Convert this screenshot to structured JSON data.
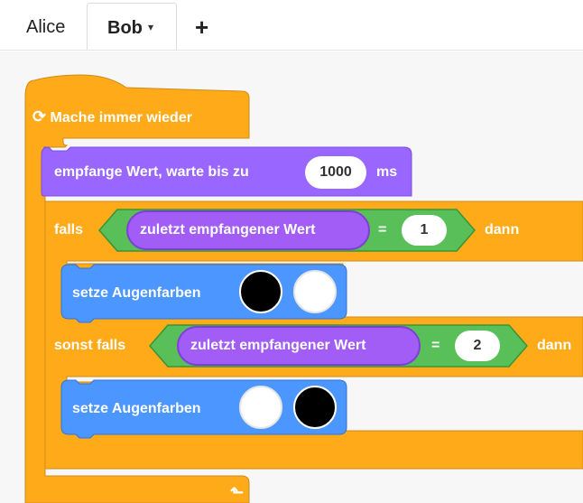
{
  "tabs": {
    "alice": "Alice",
    "bob": "Bob",
    "bob_caret": "▾",
    "add": "+"
  },
  "script": {
    "forever_label": "Mache immer wieder",
    "forever_icon": "repeat-arrow-icon",
    "forever_end_icon": "loop-up-arrow-icon",
    "receive_block": {
      "label_before": "empfange Wert, warte bis zu",
      "timeout_value": "1000",
      "label_after": "ms"
    },
    "if_block": {
      "if_label": "falls",
      "then_label": "dann",
      "reporter_label": "zuletzt empfangener Wert",
      "operator": "=",
      "compare_value": "1"
    },
    "set_eyes_1": {
      "label": "setze Augenfarben",
      "left_eye": "#000000",
      "right_eye": "#ffffff"
    },
    "elseif_block": {
      "elseif_label": "sonst falls",
      "then_label": "dann",
      "reporter_label": "zuletzt empfangener Wert",
      "operator": "=",
      "compare_value": "2"
    },
    "set_eyes_2": {
      "label": "setze Augenfarben",
      "left_eye": "#ffffff",
      "right_eye": "#000000"
    }
  },
  "colors": {
    "control": "#ffab19",
    "control_dark": "#cf8b17",
    "sensing": "#9966ff",
    "reporter": "#a15df5",
    "operator": "#59c059",
    "looks": "#4c97ff"
  }
}
